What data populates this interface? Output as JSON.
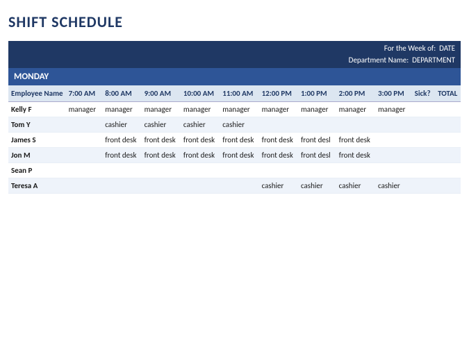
{
  "title": "SHIFT SCHEDULE",
  "week_info": {
    "for_week_label": "For the Week of:",
    "date_value": "DATE",
    "dept_label": "Department Name:",
    "dept_value": "DEPARTMENT"
  },
  "day": "MONDAY",
  "columns": [
    "Employee Name",
    "7:00 AM",
    "8:00 AM",
    "9:00 AM",
    "10:00 AM",
    "11:00 AM",
    "12:00 PM",
    "1:00 PM",
    "2:00 PM",
    "3:00 PM",
    "Sick?",
    "TOTAL"
  ],
  "rows": [
    {
      "name": "Kelly F",
      "slots": [
        "manager",
        "manager",
        "manager",
        "manager",
        "manager",
        "manager",
        "manager",
        "manager",
        "manager",
        "",
        ""
      ]
    },
    {
      "name": "Tom Y",
      "slots": [
        "",
        "cashier",
        "cashier",
        "cashier",
        "cashier",
        "",
        "",
        "",
        "",
        "",
        ""
      ]
    },
    {
      "name": "James S",
      "slots": [
        "",
        "front desk",
        "front desk",
        "front desk",
        "front desk",
        "front desk",
        "front desl",
        "front desk",
        "",
        "",
        ""
      ]
    },
    {
      "name": "Jon M",
      "slots": [
        "",
        "front desk",
        "front desk",
        "front desk",
        "front desk",
        "front desk",
        "front desl",
        "front desk",
        "",
        "",
        ""
      ]
    },
    {
      "name": "Sean P",
      "slots": [
        "",
        "",
        "",
        "",
        "",
        "",
        "",
        "",
        "",
        "",
        ""
      ]
    },
    {
      "name": "Teresa A",
      "slots": [
        "",
        "",
        "",
        "",
        "",
        "cashier",
        "cashier",
        "cashier",
        "cashier",
        "",
        ""
      ]
    }
  ]
}
